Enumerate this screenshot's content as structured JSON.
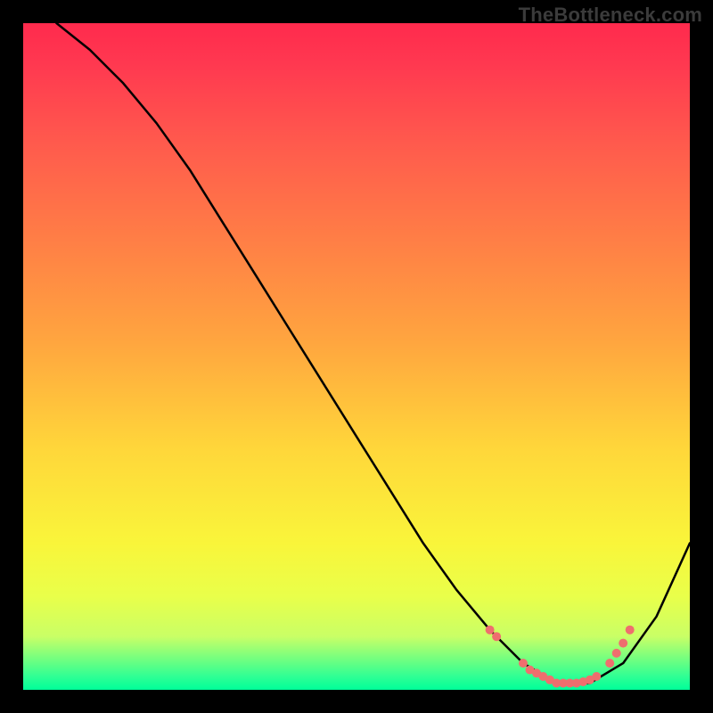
{
  "watermark": "TheBottleneck.com",
  "colors": {
    "background": "#000000",
    "curve": "#000000",
    "dots": "#ef6e6e"
  },
  "chart_data": {
    "type": "line",
    "title": "",
    "xlabel": "",
    "ylabel": "",
    "xlim": [
      0,
      100
    ],
    "ylim": [
      0,
      100
    ],
    "description": "Bottleneck percentage curve with a V-shaped minimum near x≈80; background gradient encodes magnitude (red=high bottleneck, green=no bottleneck).",
    "series": [
      {
        "name": "bottleneck-curve",
        "x": [
          5,
          10,
          15,
          20,
          25,
          30,
          35,
          40,
          45,
          50,
          55,
          60,
          65,
          70,
          75,
          80,
          85,
          90,
          95,
          100
        ],
        "values": [
          100,
          96,
          91,
          85,
          78,
          70,
          62,
          54,
          46,
          38,
          30,
          22,
          15,
          9,
          4,
          1,
          1,
          4,
          11,
          22
        ]
      }
    ],
    "highlight_points": {
      "name": "measured-components",
      "x": [
        70,
        71,
        75,
        76,
        77,
        78,
        79,
        80,
        81,
        82,
        83,
        84,
        85,
        86,
        88,
        89,
        90,
        91
      ],
      "values": [
        9,
        8,
        4,
        3,
        2.5,
        2,
        1.5,
        1,
        1,
        1,
        1,
        1.2,
        1.5,
        2,
        4,
        5.5,
        7,
        9
      ]
    }
  }
}
